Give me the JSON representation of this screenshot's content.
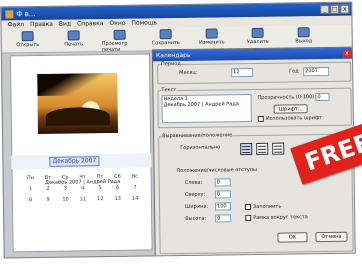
{
  "window": {
    "title": "Ф в...",
    "menu": [
      "Файл",
      "Правка",
      "Вид",
      "Справка",
      "Окно",
      "Помощь"
    ]
  },
  "toolbar": [
    {
      "label": "Открыть",
      "icon": "folder-icon"
    },
    {
      "label": "Печать",
      "icon": "printer-icon"
    },
    {
      "label": "Просмотр печати",
      "icon": "preview-icon"
    },
    {
      "label": "Сохранить",
      "icon": "save-icon"
    },
    {
      "label": "Изменить",
      "icon": "edit-icon"
    },
    {
      "label": "Удалить",
      "icon": "delete-icon"
    },
    {
      "label": "Выход",
      "icon": "exit-icon"
    }
  ],
  "document": {
    "caption": "Декабрь 2007 | Андрей Рада",
    "calendar_title": "Декабрь 2007",
    "weekdays": [
      "Пн",
      "Вт",
      "Ср",
      "Чт",
      "Пт",
      "Сб",
      "Вс"
    ],
    "days": [
      "1",
      "2",
      "3",
      "4",
      "5",
      "6",
      "7",
      "8",
      "9",
      "10",
      "11",
      "12",
      "13",
      "14"
    ]
  },
  "dialog": {
    "title": "Календарь",
    "period_group": "Период",
    "month_label": "Месяц:",
    "month_value": "12",
    "year_label": "Год",
    "year_value": "2007",
    "text_group": "Текст",
    "text_lines": [
      "Неделя 1",
      "Декабрь 2007 | Андрей Рада"
    ],
    "transparency_label": "Прозрачность (0-100):",
    "transparency_value": "0",
    "font_button": "Шрифт...",
    "font_check_label": "Использовать шрифт",
    "alignment_group": "Выравнивание/положение",
    "horizontal_label": "Горизонтально",
    "position_group": "Положение/числовые отступы",
    "fields": [
      {
        "label": "Слева:",
        "value": "0"
      },
      {
        "label": "Сверху:",
        "value": "0"
      },
      {
        "label": "Ширина:",
        "value": "100"
      },
      {
        "label": "Высота:",
        "value": "0"
      }
    ],
    "fill_check_label": "Заполнить",
    "border_check_label": "Рамка вокруг текста",
    "ok_button": "OK",
    "cancel_button": "Отмена"
  },
  "badge": {
    "text": "FREE",
    "color": "#e2211b"
  }
}
